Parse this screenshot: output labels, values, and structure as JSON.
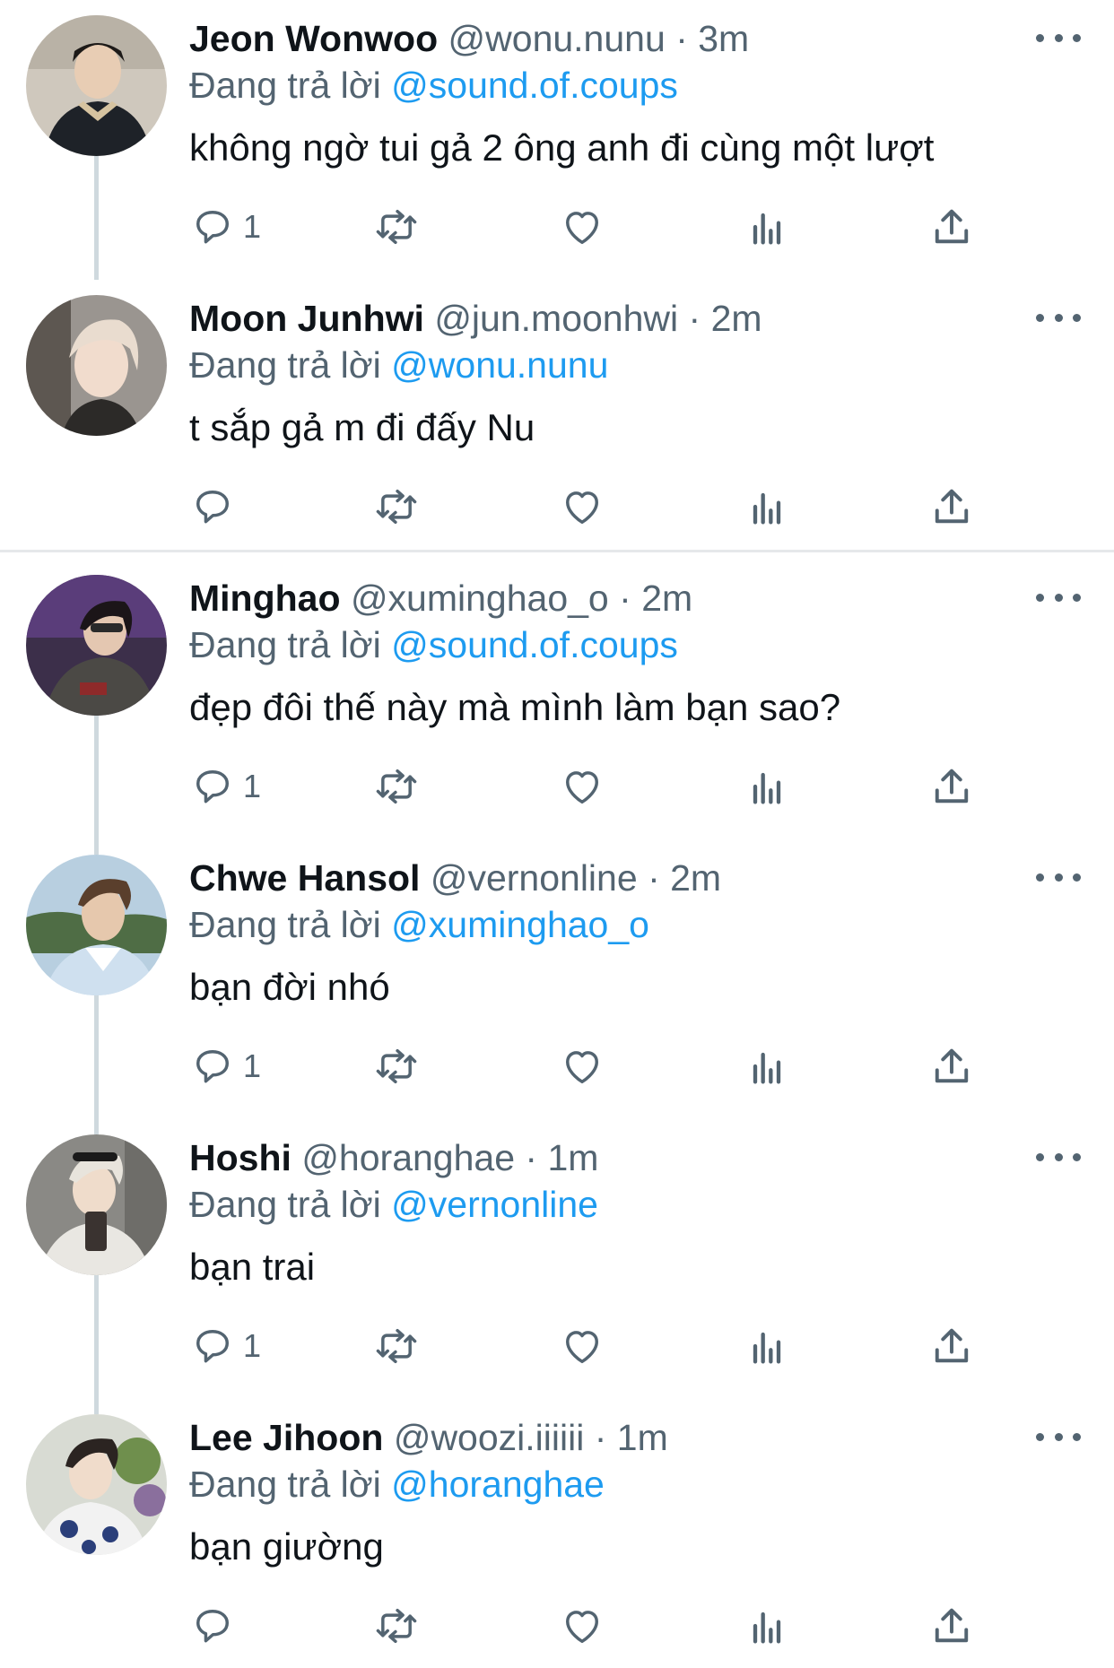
{
  "reply_prefix": "Đang trả lời",
  "colors": {
    "accent": "#1d9bf0",
    "text": "#0f1419",
    "muted": "#536471"
  },
  "tweets": [
    {
      "name": "Jeon Wonwoo",
      "handle": "@wonu.nunu",
      "sep": "·",
      "time": "3m",
      "replying_to": "@sound.of.coups",
      "text": "không ngờ tui gả 2 ông anh đi cùng một lượt",
      "reply_count": "1"
    },
    {
      "name": "Moon Junhwi",
      "handle": "@jun.moonhwi",
      "sep": "·",
      "time": "2m",
      "replying_to": "@wonu.nunu",
      "text": "t sắp gả m đi đấy Nu",
      "reply_count": ""
    },
    {
      "name": "Minghao",
      "handle": "@xuminghao_o",
      "sep": "·",
      "time": "2m",
      "replying_to": "@sound.of.coups",
      "text": "đẹp đôi thế này mà mình làm bạn sao?",
      "reply_count": "1"
    },
    {
      "name": "Chwe Hansol",
      "handle": "@vernonline",
      "sep": "·",
      "time": "2m",
      "replying_to": "@xuminghao_o",
      "text": "bạn đời nhó",
      "reply_count": "1"
    },
    {
      "name": "Hoshi",
      "handle": "@horanghae",
      "sep": "·",
      "time": "1m",
      "replying_to": "@vernonline",
      "text": "bạn trai",
      "reply_count": "1"
    },
    {
      "name": "Lee Jihoon",
      "handle": "@woozi.iiiiii",
      "sep": "·",
      "time": "1m",
      "replying_to": "@horanghae",
      "text": "bạn giường",
      "reply_count": ""
    }
  ]
}
